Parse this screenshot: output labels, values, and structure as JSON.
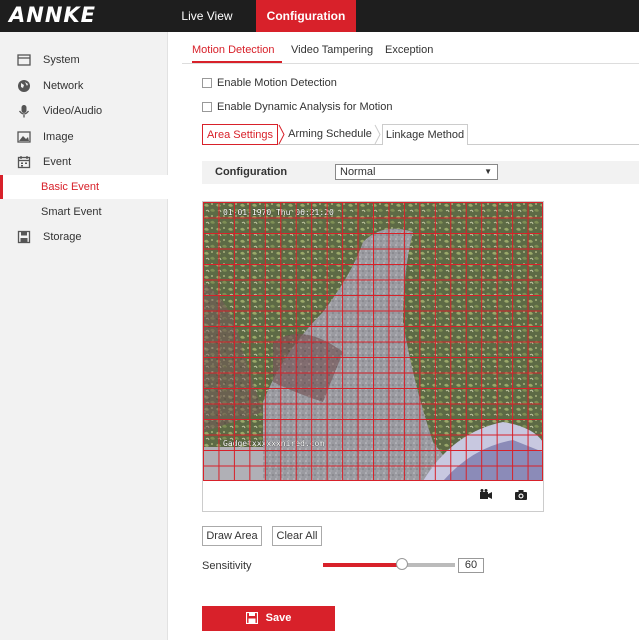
{
  "header": {
    "logo_text": "ANNKE",
    "nav": [
      "Live View",
      "Configuration"
    ],
    "active_nav": "Configuration"
  },
  "sidebar": {
    "items": [
      {
        "label": "System",
        "icon": "monitor-icon"
      },
      {
        "label": "Network",
        "icon": "globe-icon"
      },
      {
        "label": "Video/Audio",
        "icon": "microphone-icon"
      },
      {
        "label": "Image",
        "icon": "image-icon"
      },
      {
        "label": "Event",
        "icon": "calendar-icon"
      },
      {
        "label": "Basic Event",
        "sub": true,
        "active": true
      },
      {
        "label": "Smart Event",
        "sub": true
      },
      {
        "label": "Storage",
        "icon": "save-icon"
      }
    ]
  },
  "tabs": [
    "Motion Detection",
    "Video Tampering",
    "Exception"
  ],
  "active_tab": "Motion Detection",
  "checkboxes": {
    "enable_motion": {
      "label": "Enable Motion Detection",
      "checked": false
    },
    "enable_dynamic": {
      "label": "Enable Dynamic Analysis for Motion",
      "checked": false
    }
  },
  "subtabs": [
    "Area Settings",
    "Arming Schedule",
    "Linkage Method"
  ],
  "active_subtab": "Area Settings",
  "configuration": {
    "label": "Configuration",
    "selected": "Normal"
  },
  "video": {
    "timestamp": "01-01-1970 Thu 06:21:20",
    "watermark": "Gadgetxxxxxxnired.com",
    "grid_cols": 22,
    "grid_rows": 18
  },
  "buttons": {
    "draw_area": "Draw Area",
    "clear_all": "Clear All",
    "save": "Save"
  },
  "sensitivity": {
    "label": "Sensitivity",
    "value": "60",
    "level_percent": 60
  },
  "colors": {
    "accent": "#d8212a",
    "topbar": "#1e1e1e",
    "sidebar": "#f2f2f2"
  }
}
